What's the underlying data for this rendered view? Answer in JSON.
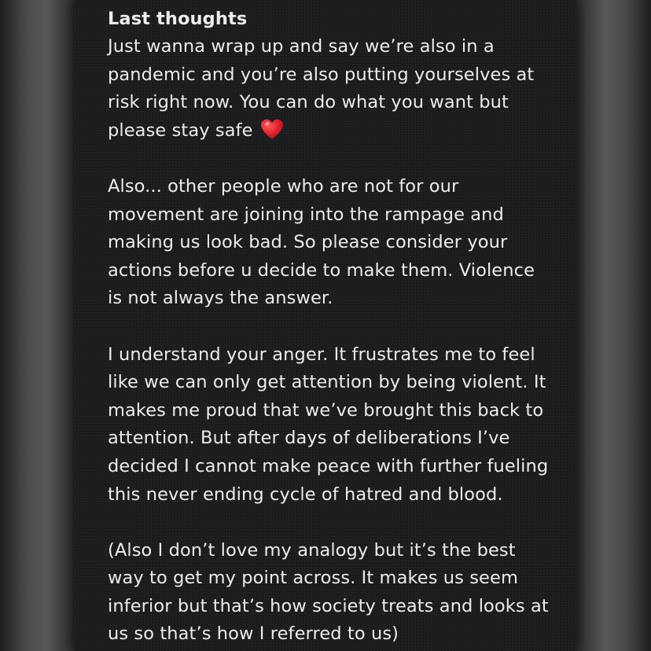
{
  "note": {
    "title": "Last thoughts",
    "paragraphs": [
      {
        "text": "Just wanna wrap up and say we’re also in a\npandemic and you’re also putting yourselves at\nrisk right now. You can do what you want but\nplease stay safe ",
        "emoji": "red-heart-icon"
      },
      {
        "text": "Also... other people who are not for our\nmovement are joining into the rampage and\nmaking us look bad. So please consider your\nactions before u decide to make them. Violence\nis not always the answer."
      },
      {
        "text": "I understand your anger. It frustrates me to feel\nlike we can only get attention by being violent. It\nmakes me proud that we’ve brought this back to\nattention. But after days of deliberations I’ve\ndecided I cannot make peace with further fueling\nthis never ending cycle of hatred and blood."
      },
      {
        "text": "(Also I don’t love my analogy but it’s the best\nway to get my point across. It makes us seem\ninferior but that’s how society treats and looks at\nus so that’s how I referred to us)"
      }
    ]
  },
  "colors": {
    "note_background": "#1c1c1e",
    "text": "#ececec",
    "heart": "#e0202e"
  }
}
